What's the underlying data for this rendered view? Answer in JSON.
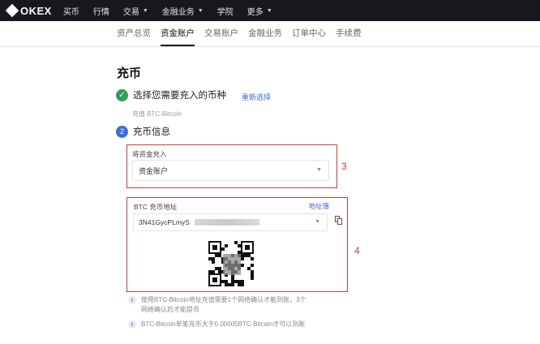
{
  "nav": {
    "logo": "OKEX",
    "items": [
      {
        "label": "买币",
        "dropdown": false
      },
      {
        "label": "行情",
        "dropdown": false
      },
      {
        "label": "交易",
        "dropdown": true
      },
      {
        "label": "金融业务",
        "dropdown": true
      },
      {
        "label": "学院",
        "dropdown": false
      },
      {
        "label": "更多",
        "dropdown": true
      }
    ]
  },
  "subnav": {
    "tabs": [
      {
        "label": "资产总览",
        "active": false
      },
      {
        "label": "资金账户",
        "active": true
      },
      {
        "label": "交易账户",
        "active": false
      },
      {
        "label": "金融业务",
        "active": false
      },
      {
        "label": "订单中心",
        "active": false
      },
      {
        "label": "手续费",
        "active": false
      }
    ]
  },
  "page": {
    "title": "充币"
  },
  "step1": {
    "title": "选择您需要充入的币种",
    "link": "重新选择",
    "subtitle": "充值 BTC-Bitcoin"
  },
  "step2": {
    "number": "2",
    "title": "充币信息",
    "deposit_to": {
      "label": "将资金充入",
      "value": "资金账户"
    },
    "address": {
      "label": "BTC 充币地址",
      "link": "地址簿",
      "value": "3N41GycPLmyS"
    }
  },
  "annotations": {
    "box3": "3",
    "box4": "4"
  },
  "notes": [
    {
      "line1": "使用BTC-Bitcoin地址充值需要1个网络确认才能到账，3个",
      "line2": "网络确认后才能提币"
    },
    {
      "line1": "BTC-Bitcoin单笔充币大于0.00005BTC-Bitcoin才可以到账"
    }
  ],
  "colors": {
    "accent": "#3a6fd8",
    "success": "#2e9e5b",
    "annotation": "#d23b3b",
    "topbar": "#17181d"
  }
}
